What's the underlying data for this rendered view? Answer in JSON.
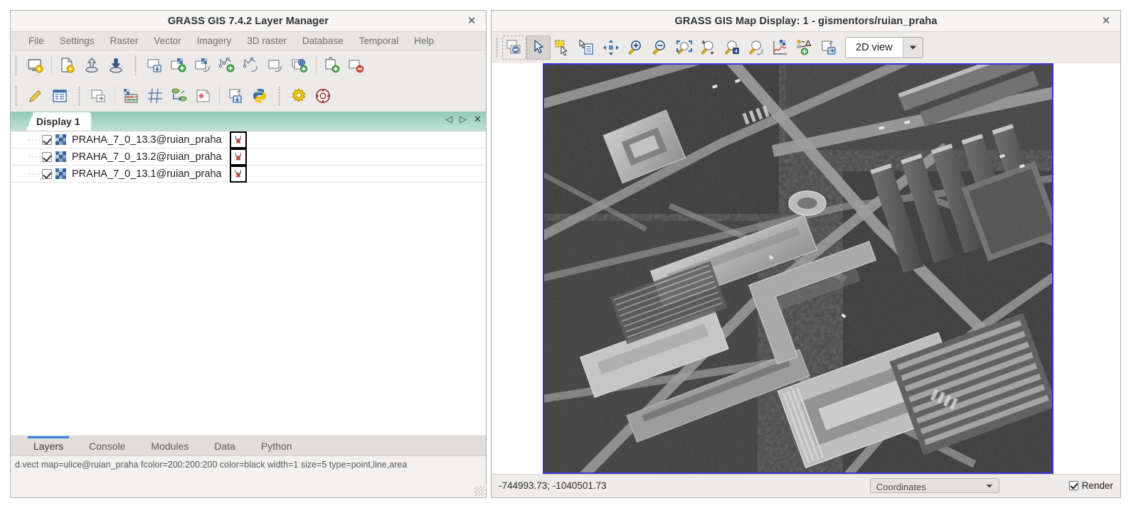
{
  "layer_manager": {
    "title": "GRASS GIS 7.4.2 Layer Manager",
    "close_label": "✕",
    "menu": [
      "File",
      "Settings",
      "Raster",
      "Vector",
      "Imagery",
      "3D raster",
      "Database",
      "Temporal",
      "Help"
    ],
    "toolbar_row1": [
      {
        "name": "start-new-workspace-icon",
        "tip": "Start new workspace"
      },
      {
        "name": "open-workspace-icon",
        "tip": "Open existing workspace file"
      },
      {
        "name": "load-workspace-icon",
        "tip": "Load map layers into workspace"
      },
      {
        "name": "save-workspace-icon",
        "tip": "Save current workspace to file"
      },
      {
        "name": "add-multiple-raster-vector-icon",
        "tip": "Add multiple raster or vector map layers"
      },
      {
        "name": "add-raster-map-layer-icon",
        "tip": "Add raster map layer"
      },
      {
        "name": "add-various-raster-icon",
        "tip": "Add various raster map layers"
      },
      {
        "name": "add-vector-map-layer-icon",
        "tip": "Add vector map layer"
      },
      {
        "name": "add-various-vector-icon",
        "tip": "Add various vector map layers"
      },
      {
        "name": "add-group-icon",
        "tip": "Add group"
      },
      {
        "name": "add-web-service-layer-icon",
        "tip": "Add web service layer"
      },
      {
        "name": "add-command-layer-icon",
        "tip": "Add command layer"
      },
      {
        "name": "remove-map-layer-icon",
        "tip": "Remove selected map layer"
      }
    ],
    "toolbar_row2": [
      {
        "name": "edit-vector-maps-icon",
        "tip": "Edit vector maps"
      },
      {
        "name": "show-attribute-table-icon",
        "tip": "Show attribute table"
      },
      {
        "name": "add-raster-legend-icon",
        "tip": "Add raster map layer"
      },
      {
        "name": "raster-map-calculator-icon",
        "tip": "Raster map calculator"
      },
      {
        "name": "georectifier-icon",
        "tip": "Georectifier"
      },
      {
        "name": "graphical-modeler-icon",
        "tip": "Graphical modeler"
      },
      {
        "name": "cartographic-composer-icon",
        "tip": "Cartographic composer"
      },
      {
        "name": "launch-script-icon",
        "tip": "Launch script"
      },
      {
        "name": "python-shell-icon",
        "tip": "Open a simple Python code editor"
      },
      {
        "name": "gui-settings-icon",
        "tip": "Show GUI settings"
      },
      {
        "name": "help-icon",
        "tip": "Show manual"
      }
    ],
    "display_tab": {
      "label": "Display 1",
      "prev_icon": "◁",
      "next_icon": "▷",
      "close_icon": "✕"
    },
    "layers": [
      {
        "name": "PRAHA_7_0_13.3@ruian_praha",
        "checked": true,
        "icon": "raster-layer-icon"
      },
      {
        "name": "PRAHA_7_0_13.2@ruian_praha",
        "checked": true,
        "icon": "raster-layer-icon"
      },
      {
        "name": "PRAHA_7_0_13.1@ruian_praha",
        "checked": true,
        "icon": "raster-layer-icon"
      }
    ],
    "notebook_tabs": [
      {
        "label": "Layers",
        "active": true
      },
      {
        "label": "Console",
        "active": false
      },
      {
        "label": "Modules",
        "active": false
      },
      {
        "label": "Data",
        "active": false
      },
      {
        "label": "Python",
        "active": false
      }
    ],
    "statusbar_text": "d.vect map=ulice@ruian_praha fcolor=200:200:200 color=black width=1 size=5 type=point,line,area"
  },
  "map_display": {
    "title": "GRASS GIS Map Display: 1 - gismentors/ruian_praha",
    "close_label": "✕",
    "toolbar": [
      {
        "name": "render-map-icon",
        "tip": "Render map",
        "pressed": false
      },
      {
        "name": "pointer-icon",
        "tip": "Pointer",
        "pressed": true
      },
      {
        "name": "select-features-icon",
        "tip": "Select features",
        "pressed": false
      },
      {
        "name": "query-raster-vector-icon",
        "tip": "Query raster/vector map(s)",
        "pressed": false
      },
      {
        "name": "pan-icon",
        "tip": "Pan",
        "pressed": false
      },
      {
        "name": "zoom-in-icon",
        "tip": "Zoom in",
        "pressed": false
      },
      {
        "name": "zoom-out-icon",
        "tip": "Zoom out",
        "pressed": false
      },
      {
        "name": "zoom-to-selected-map-icon",
        "tip": "Various zoom options",
        "pressed": false
      },
      {
        "name": "zoom-to-computational-region-icon",
        "tip": "Return to previous zoom",
        "pressed": false
      },
      {
        "name": "zoom-back-icon",
        "tip": "Return to previous zoom",
        "pressed": false
      },
      {
        "name": "zoom-to-saved-region-icon",
        "tip": "Zoom to saved region",
        "pressed": false
      },
      {
        "name": "analyze-map-icon",
        "tip": "Analyze map",
        "pressed": false
      },
      {
        "name": "add-map-elements-icon",
        "tip": "Add map elements",
        "pressed": false
      },
      {
        "name": "save-display-to-file-icon",
        "tip": "Save display to file",
        "pressed": false
      }
    ],
    "view_mode": {
      "value": "2D view",
      "arrow": "▼"
    },
    "status": {
      "coordinates": "-744993.73; -1040501.73",
      "mode_combo": {
        "value": "Coordinates",
        "arrow": "▼"
      },
      "render_label": "Render",
      "render_checked": true
    }
  },
  "colors": {
    "accent_blue": "#3b82d6",
    "map_border": "#3c34d8",
    "tab_green": "#a8d6c6",
    "chrome": "#f2f1f0"
  }
}
